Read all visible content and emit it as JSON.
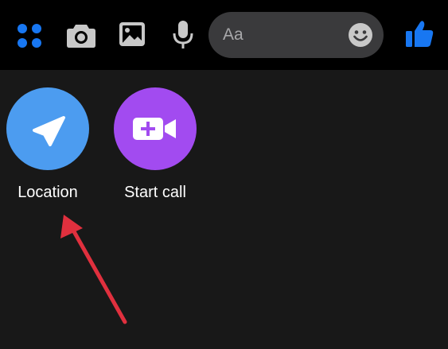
{
  "composer": {
    "placeholder": "Aa"
  },
  "toolbar": {
    "icons": [
      "apps-grid-icon",
      "camera-icon",
      "gallery-icon",
      "microphone-icon",
      "emoji-icon",
      "thumbs-up-icon"
    ],
    "accent_color": "#1877f2"
  },
  "actions": [
    {
      "label": "Location",
      "icon": "location-arrow-icon",
      "color": "#4c9cf0"
    },
    {
      "label": "Start call",
      "icon": "video-call-add-icon",
      "color": "#a24bf0"
    }
  ],
  "annotation": {
    "arrow_color": "#e0303e"
  }
}
